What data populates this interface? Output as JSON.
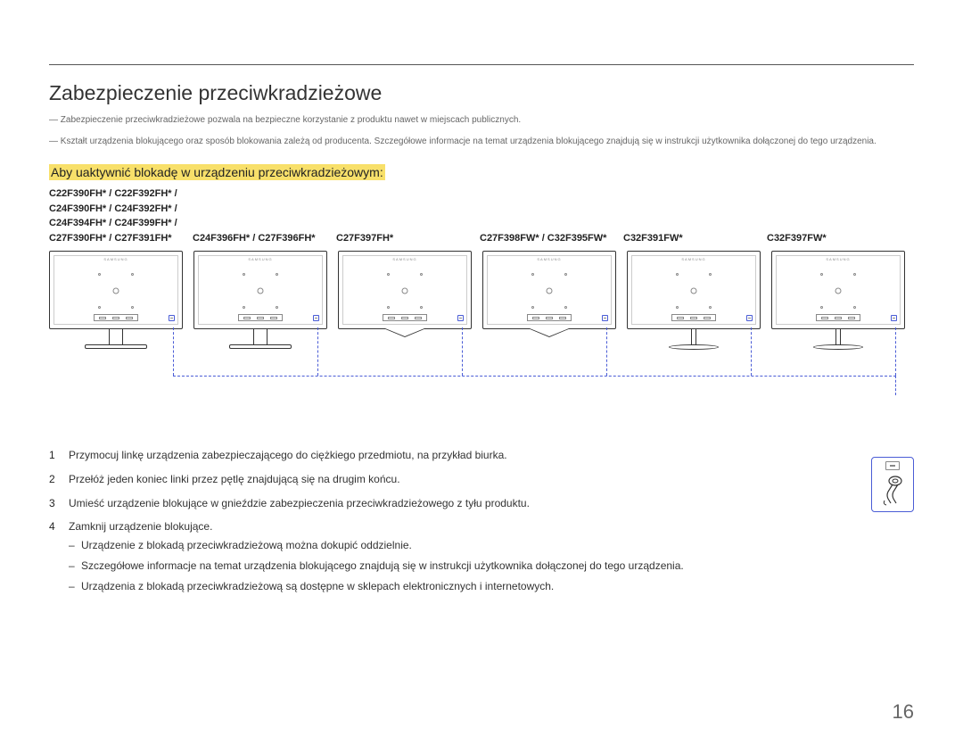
{
  "section_title": "Zabezpieczenie przeciwkradzieżowe",
  "notes": [
    "Zabezpieczenie przeciwkradzieżowe pozwala na bezpieczne korzystanie z produktu nawet w miejscach publicznych.",
    "Kształt urządzenia blokującego oraz sposób blokowania zależą od producenta. Szczegółowe informacje na temat urządzenia blokującego znajdują się w instrukcji użytkownika dołączonej do tego urządzenia."
  ],
  "sub_title": "Aby uaktywnić blokadę w urządzeniu przeciwkradzieżowym:",
  "models": [
    "C22F390FH* / C22F392FH* /\nC24F390FH* / C24F392FH* /\nC24F394FH* / C24F399FH* /\nC27F390FH* / C27F391FH*",
    "C24F396FH* / C27F396FH*",
    "C27F397FH*",
    "C27F398FW* / C32F395FW*",
    "C32F391FW*",
    "C32F397FW*"
  ],
  "brand": "SAMSUNG",
  "steps": [
    "Przymocuj linkę urządzenia zabezpieczającego do ciężkiego przedmiotu, na przykład biurka.",
    "Przełóż jeden koniec linki przez pętlę znajdującą się na drugim końcu.",
    "Umieść urządzenie blokujące w gnieździe zabezpieczenia przeciwkradzieżowego z tyłu produktu.",
    "Zamknij urządzenie blokujące."
  ],
  "bullets": [
    "Urządzenie z blokadą przeciwkradzieżową można dokupić oddzielnie.",
    "Szczegółowe informacje na temat urządzenia blokującego znajdują się w instrukcji użytkownika dołączonej do tego urządzenia.",
    "Urządzenia z blokadą przeciwkradzieżową są dostępne w sklepach elektronicznych i internetowych."
  ],
  "page_number": "16"
}
